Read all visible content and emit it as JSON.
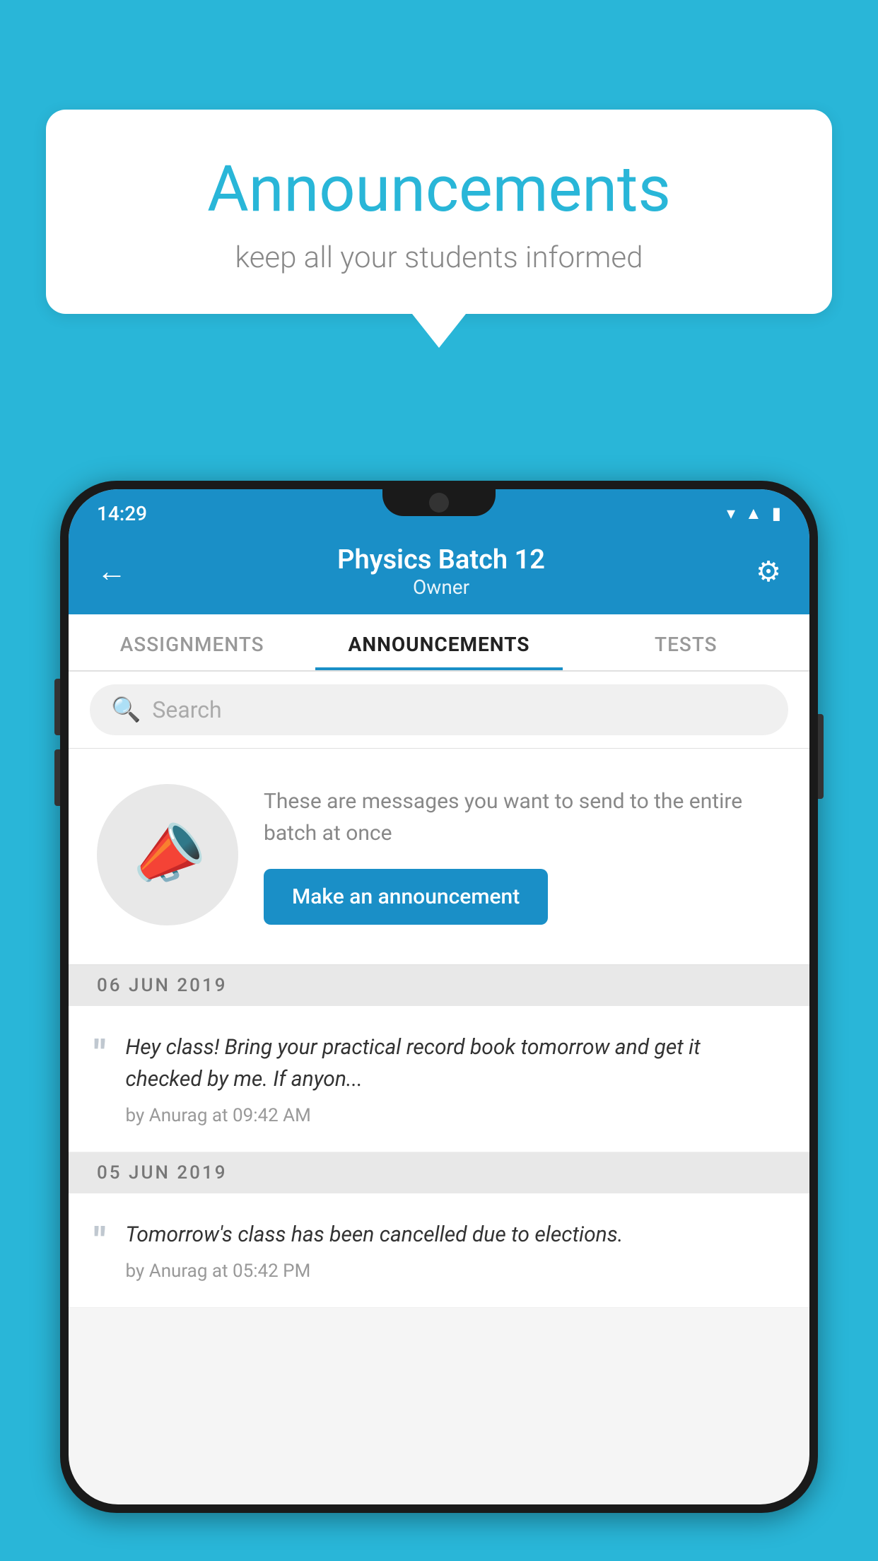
{
  "background": {
    "color": "#29b6d8"
  },
  "speech_bubble": {
    "title": "Announcements",
    "subtitle": "keep all your students informed"
  },
  "phone": {
    "status_bar": {
      "time": "14:29",
      "icons": [
        "wifi",
        "signal",
        "battery"
      ]
    },
    "header": {
      "back_label": "←",
      "title": "Physics Batch 12",
      "subtitle": "Owner",
      "gear_label": "⚙"
    },
    "tabs": [
      {
        "label": "ASSIGNMENTS",
        "active": false
      },
      {
        "label": "ANNOUNCEMENTS",
        "active": true
      },
      {
        "label": "TESTS",
        "active": false
      }
    ],
    "search": {
      "placeholder": "Search"
    },
    "announcement_prompt": {
      "description": "These are messages you want to send to the entire batch at once",
      "button_label": "Make an announcement"
    },
    "announcements": [
      {
        "date": "06  JUN  2019",
        "message": "Hey class! Bring your practical record book tomorrow and get it checked by me. If anyon...",
        "meta": "by Anurag at 09:42 AM"
      },
      {
        "date": "05  JUN  2019",
        "message": "Tomorrow's class has been cancelled due to elections.",
        "meta": "by Anurag at 05:42 PM"
      }
    ]
  }
}
